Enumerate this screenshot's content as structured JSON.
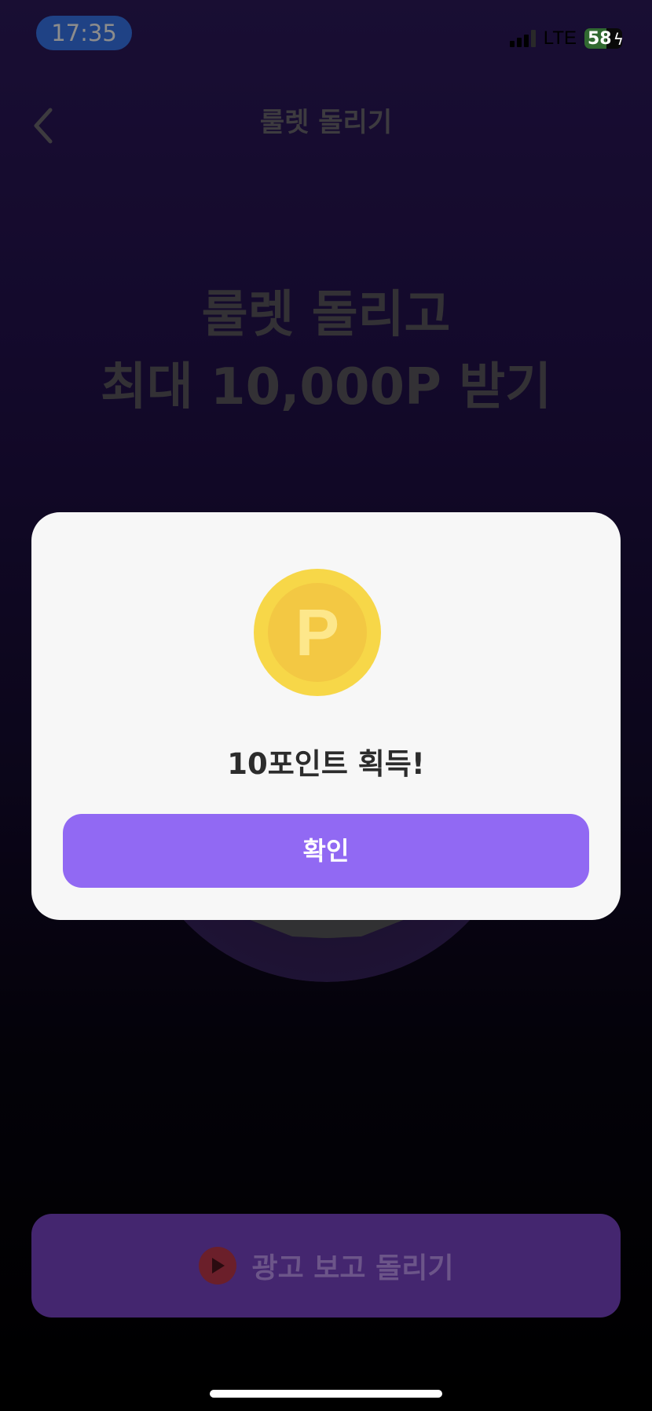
{
  "status_bar": {
    "time": "17:35",
    "network": "LTE",
    "battery": "58",
    "battery_level": 0.58,
    "signal_bars_active": 3,
    "signal_bars_total": 4
  },
  "navbar": {
    "title": "룰렛 돌리기",
    "back_icon": "chevron-left-icon"
  },
  "headline": {
    "line1": "룰렛 돌리고",
    "line2": "최대 10,000P 받기"
  },
  "modal": {
    "coin_letter": "P",
    "coin_icon": "point-coin-icon",
    "message": "10포인트 획득!",
    "confirm_label": "확인"
  },
  "bottom_button": {
    "label": "광고 보고 돌리기",
    "icon": "play-icon"
  },
  "colors": {
    "accent": "#9169f3",
    "coin": "#f7d748",
    "background_top": "#2e1a5e",
    "bottom_button": "#44266f"
  }
}
